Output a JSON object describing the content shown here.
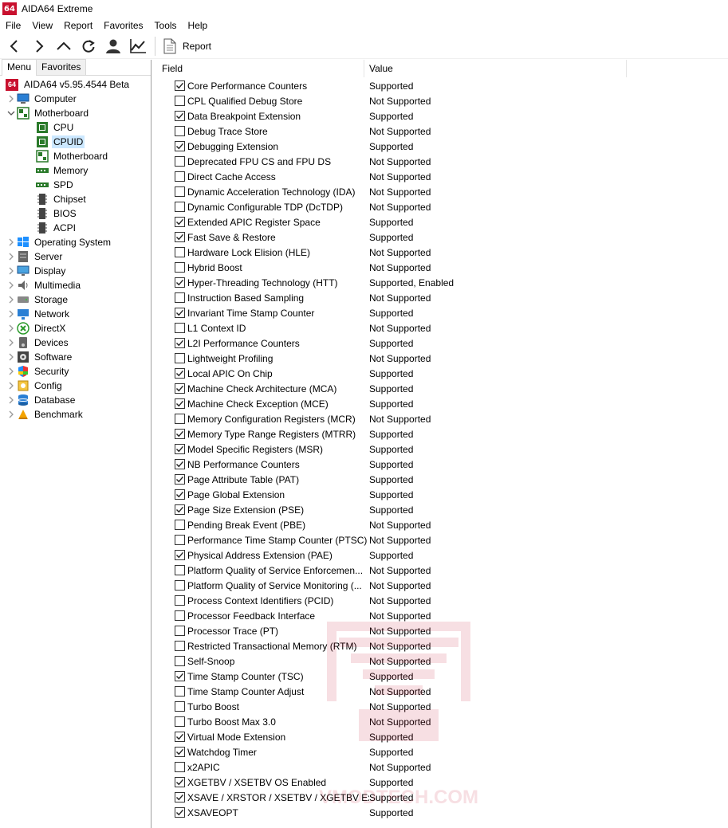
{
  "window": {
    "title": "AIDA64 Extreme",
    "logo_text": "64"
  },
  "menu": [
    "File",
    "View",
    "Report",
    "Favorites",
    "Tools",
    "Help"
  ],
  "toolbar": {
    "report_label": "Report"
  },
  "tabs": {
    "menu": "Menu",
    "favorites": "Favorites"
  },
  "tree": {
    "root": "AIDA64 v5.95.4544 Beta",
    "items": [
      {
        "label": "Computer",
        "icon": "computer-icon",
        "expanded": false
      },
      {
        "label": "Motherboard",
        "icon": "motherboard-icon",
        "expanded": true,
        "children": [
          {
            "label": "CPU",
            "icon": "cpu-icon"
          },
          {
            "label": "CPUID",
            "icon": "cpuid-icon",
            "selected": true
          },
          {
            "label": "Motherboard",
            "icon": "motherboard-icon"
          },
          {
            "label": "Memory",
            "icon": "memory-icon"
          },
          {
            "label": "SPD",
            "icon": "spd-icon"
          },
          {
            "label": "Chipset",
            "icon": "chipset-icon"
          },
          {
            "label": "BIOS",
            "icon": "bios-icon"
          },
          {
            "label": "ACPI",
            "icon": "acpi-icon"
          }
        ]
      },
      {
        "label": "Operating System",
        "icon": "windows-icon",
        "expanded": false
      },
      {
        "label": "Server",
        "icon": "server-icon",
        "expanded": false
      },
      {
        "label": "Display",
        "icon": "display-icon",
        "expanded": false
      },
      {
        "label": "Multimedia",
        "icon": "multimedia-icon",
        "expanded": false
      },
      {
        "label": "Storage",
        "icon": "storage-icon",
        "expanded": false
      },
      {
        "label": "Network",
        "icon": "network-icon",
        "expanded": false
      },
      {
        "label": "DirectX",
        "icon": "directx-icon",
        "expanded": false
      },
      {
        "label": "Devices",
        "icon": "devices-icon",
        "expanded": false
      },
      {
        "label": "Software",
        "icon": "software-icon",
        "expanded": false
      },
      {
        "label": "Security",
        "icon": "security-icon",
        "expanded": false
      },
      {
        "label": "Config",
        "icon": "config-icon",
        "expanded": false
      },
      {
        "label": "Database",
        "icon": "database-icon",
        "expanded": false
      },
      {
        "label": "Benchmark",
        "icon": "benchmark-icon",
        "expanded": false
      }
    ]
  },
  "columns": {
    "field": "Field",
    "value": "Value"
  },
  "rows": [
    {
      "field": "Core Performance Counters",
      "value": "Supported",
      "checked": true
    },
    {
      "field": "CPL Qualified Debug Store",
      "value": "Not Supported",
      "checked": false
    },
    {
      "field": "Data Breakpoint Extension",
      "value": "Supported",
      "checked": true
    },
    {
      "field": "Debug Trace Store",
      "value": "Not Supported",
      "checked": false
    },
    {
      "field": "Debugging Extension",
      "value": "Supported",
      "checked": true
    },
    {
      "field": "Deprecated FPU CS and FPU DS",
      "value": "Not Supported",
      "checked": false
    },
    {
      "field": "Direct Cache Access",
      "value": "Not Supported",
      "checked": false
    },
    {
      "field": "Dynamic Acceleration Technology (IDA)",
      "value": "Not Supported",
      "checked": false
    },
    {
      "field": "Dynamic Configurable TDP (DcTDP)",
      "value": "Not Supported",
      "checked": false
    },
    {
      "field": "Extended APIC Register Space",
      "value": "Supported",
      "checked": true
    },
    {
      "field": "Fast Save & Restore",
      "value": "Supported",
      "checked": true
    },
    {
      "field": "Hardware Lock Elision (HLE)",
      "value": "Not Supported",
      "checked": false
    },
    {
      "field": "Hybrid Boost",
      "value": "Not Supported",
      "checked": false
    },
    {
      "field": "Hyper-Threading Technology (HTT)",
      "value": "Supported, Enabled",
      "checked": true
    },
    {
      "field": "Instruction Based Sampling",
      "value": "Not Supported",
      "checked": false
    },
    {
      "field": "Invariant Time Stamp Counter",
      "value": "Supported",
      "checked": true
    },
    {
      "field": "L1 Context ID",
      "value": "Not Supported",
      "checked": false
    },
    {
      "field": "L2I Performance Counters",
      "value": "Supported",
      "checked": true
    },
    {
      "field": "Lightweight Profiling",
      "value": "Not Supported",
      "checked": false
    },
    {
      "field": "Local APIC On Chip",
      "value": "Supported",
      "checked": true
    },
    {
      "field": "Machine Check Architecture (MCA)",
      "value": "Supported",
      "checked": true
    },
    {
      "field": "Machine Check Exception (MCE)",
      "value": "Supported",
      "checked": true
    },
    {
      "field": "Memory Configuration Registers (MCR)",
      "value": "Not Supported",
      "checked": false
    },
    {
      "field": "Memory Type Range Registers (MTRR)",
      "value": "Supported",
      "checked": true
    },
    {
      "field": "Model Specific Registers (MSR)",
      "value": "Supported",
      "checked": true
    },
    {
      "field": "NB Performance Counters",
      "value": "Supported",
      "checked": true
    },
    {
      "field": "Page Attribute Table (PAT)",
      "value": "Supported",
      "checked": true
    },
    {
      "field": "Page Global Extension",
      "value": "Supported",
      "checked": true
    },
    {
      "field": "Page Size Extension (PSE)",
      "value": "Supported",
      "checked": true
    },
    {
      "field": "Pending Break Event (PBE)",
      "value": "Not Supported",
      "checked": false
    },
    {
      "field": "Performance Time Stamp Counter (PTSC)",
      "value": "Not Supported",
      "checked": false
    },
    {
      "field": "Physical Address Extension (PAE)",
      "value": "Supported",
      "checked": true
    },
    {
      "field": "Platform Quality of Service Enforcemen...",
      "value": "Not Supported",
      "checked": false
    },
    {
      "field": "Platform Quality of Service Monitoring (...",
      "value": "Not Supported",
      "checked": false
    },
    {
      "field": "Process Context Identifiers (PCID)",
      "value": "Not Supported",
      "checked": false
    },
    {
      "field": "Processor Feedback Interface",
      "value": "Not Supported",
      "checked": false
    },
    {
      "field": "Processor Trace (PT)",
      "value": "Not Supported",
      "checked": false
    },
    {
      "field": "Restricted Transactional Memory (RTM)",
      "value": "Not Supported",
      "checked": false
    },
    {
      "field": "Self-Snoop",
      "value": "Not Supported",
      "checked": false
    },
    {
      "field": "Time Stamp Counter (TSC)",
      "value": "Supported",
      "checked": true
    },
    {
      "field": "Time Stamp Counter Adjust",
      "value": "Not Supported",
      "checked": false
    },
    {
      "field": "Turbo Boost",
      "value": "Not Supported",
      "checked": false
    },
    {
      "field": "Turbo Boost Max 3.0",
      "value": "Not Supported",
      "checked": false
    },
    {
      "field": "Virtual Mode Extension",
      "value": "Supported",
      "checked": true
    },
    {
      "field": "Watchdog Timer",
      "value": "Supported",
      "checked": true
    },
    {
      "field": "x2APIC",
      "value": "Not Supported",
      "checked": false
    },
    {
      "field": "XGETBV / XSETBV OS Enabled",
      "value": "Supported",
      "checked": true
    },
    {
      "field": "XSAVE / XRSTOR / XSETBV / XGETBV Ext...",
      "value": "Supported",
      "checked": true
    },
    {
      "field": "XSAVEOPT",
      "value": "Supported",
      "checked": true
    }
  ],
  "watermark": {
    "text": "VMODTECH.COM"
  },
  "colors": {
    "selection": "#cce8ff",
    "brand": "#c8102e"
  }
}
